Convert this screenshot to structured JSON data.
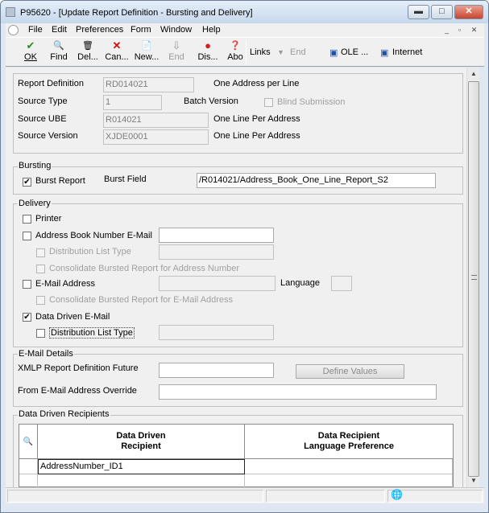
{
  "window": {
    "title": "P95620 - [Update Report Definition - Bursting and Delivery]",
    "minimize": "▬",
    "maximize": "□",
    "close": "✕"
  },
  "menu": [
    "File",
    "Edit",
    "Preferences",
    "Form",
    "Window",
    "Help"
  ],
  "mdi_buttons": [
    "_",
    "▫",
    "✕"
  ],
  "toolbar": {
    "ok": "OK",
    "find": "Find",
    "delete": "Del...",
    "cancel": "Can...",
    "new": "New...",
    "end": "End",
    "display": "Dis...",
    "about": "Abo",
    "links": "Links",
    "links_end": "End",
    "ole": "OLE ...",
    "internet": "Internet"
  },
  "icons": {
    "ok": "✔",
    "find": "🔍",
    "delete": "🗑",
    "cancel": "✕",
    "new": "📄",
    "end": "⇩",
    "display": "●",
    "about": "❓",
    "links_arrow": "▼",
    "ole": "▣",
    "internet": "▣"
  },
  "header": {
    "report_definition_label": "Report Definition",
    "report_definition_value": "RD014021",
    "one_address_label": "One Address per Line",
    "source_type_label": "Source Type",
    "source_type_value": "1",
    "batch_version_label": "Batch Version",
    "blind_submission_label": "Blind Submission",
    "source_ube_label": "Source UBE",
    "source_ube_value": "R014021",
    "one_line_label_1": "One Line Per Address",
    "source_version_label": "Source Version",
    "source_version_value": "XJDE0001",
    "one_line_label_2": "One Line Per Address"
  },
  "bursting": {
    "group_label": "Bursting",
    "burst_report_label": "Burst Report",
    "burst_report_checked": "✔",
    "burst_field_label": "Burst Field",
    "burst_field_value": "/R014021/Address_Book_One_Line_Report_S2"
  },
  "delivery": {
    "group_label": "Delivery",
    "printer_label": "Printer",
    "ab_email_label": "Address Book Number E-Mail",
    "dist_list_label": "Distribution List Type",
    "consolidate_ab_label": "Consolidate Bursted Report for Address Number",
    "email_address_label": "E-Mail Address",
    "language_label": "Language",
    "consolidate_email_label": "Consolidate Bursted Report for E-Mail Address",
    "data_driven_label": "Data Driven E-Mail",
    "data_driven_checked": "✔",
    "dd_dist_list_label": "Distribution List Type"
  },
  "email_details": {
    "group_label": "E-Mail Details",
    "xmlp_label": "XMLP Report Definition Future",
    "define_values_label": "Define Values",
    "from_override_label": "From E-Mail Address Override"
  },
  "recipients": {
    "group_label": "Data Driven Recipients",
    "grid_icon": "🔍",
    "col1_line1": "Data Driven",
    "col1_line2": "Recipient",
    "col2_line1": "Data Recipient",
    "col2_line2": "Language Preference",
    "row1_col1": "AddressNumber_ID1"
  },
  "status": {
    "globe_icon": "🌐"
  }
}
